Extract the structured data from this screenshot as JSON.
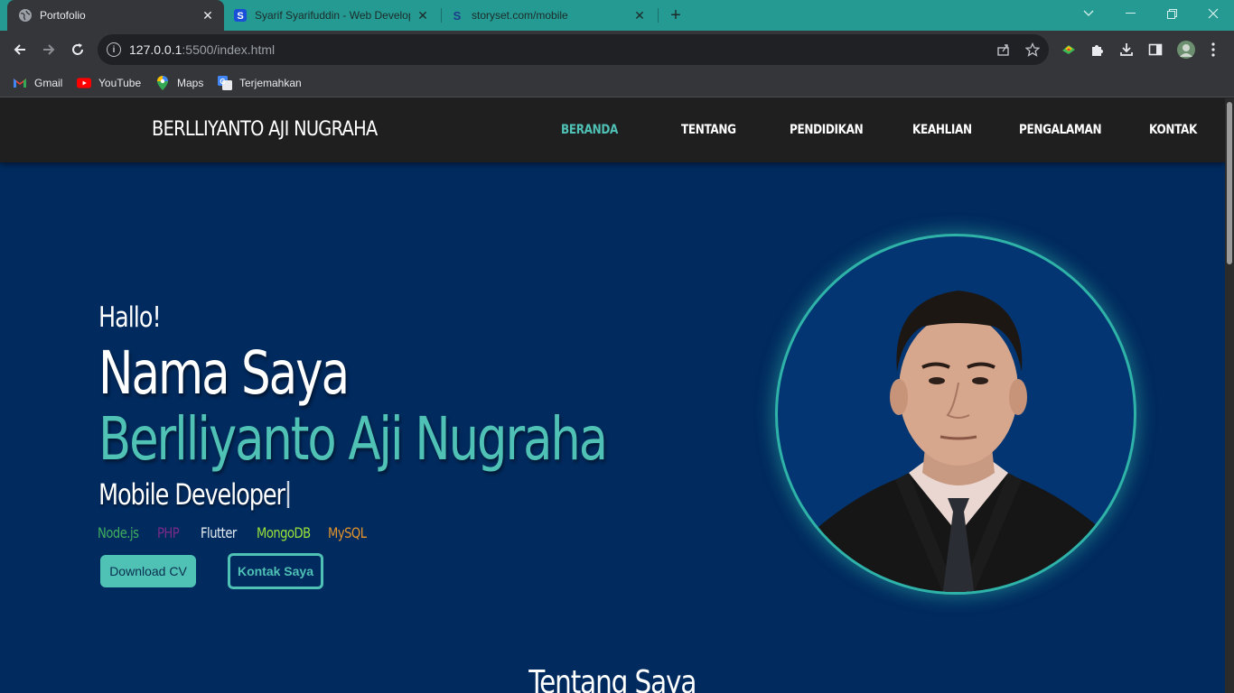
{
  "browser": {
    "tabs": [
      {
        "title": "Portofolio"
      },
      {
        "title": "Syarif Syarifuddin - Web Develop"
      },
      {
        "title": "storyset.com/mobile"
      }
    ],
    "url_host": "127.0.0.1",
    "url_rest": ":5500/index.html",
    "bookmarks": [
      {
        "label": "Gmail",
        "icon": "gmail-icon"
      },
      {
        "label": "YouTube",
        "icon": "youtube-icon"
      },
      {
        "label": "Maps",
        "icon": "maps-icon"
      },
      {
        "label": "Terjemahkan",
        "icon": "translate-icon"
      }
    ],
    "colors": {
      "tabstrip": "#249a92",
      "toolbar": "#35363a"
    }
  },
  "site": {
    "brand": "BERLLIYANTO AJI NUGRAHA",
    "nav": [
      {
        "label": "BERANDA",
        "active": true
      },
      {
        "label": "TENTANG",
        "active": false
      },
      {
        "label": "PENDIDIKAN",
        "active": false
      },
      {
        "label": "KEAHLIAN",
        "active": false
      },
      {
        "label": "PENGALAMAN",
        "active": false
      },
      {
        "label": "KONTAK",
        "active": false
      }
    ],
    "hero": {
      "greeting": "Hallo!",
      "name_label": "Nama Saya",
      "name": "Berlliyanto Aji Nugraha",
      "role": "Mobile Developer",
      "skills": [
        {
          "label": "Node.js",
          "color": "#3fae5f"
        },
        {
          "label": "PHP",
          "color": "#7a2a8a"
        },
        {
          "label": "Flutter",
          "color": "#e6edf3"
        },
        {
          "label": "MongoDB",
          "color": "#9be23a"
        },
        {
          "label": "MySQL",
          "color": "#e5952a"
        }
      ],
      "download_cv": "Download CV",
      "contact": "Kontak Saya"
    },
    "next_section_title": "Tentang Saya",
    "colors": {
      "accent": "#4fc1b5",
      "background": "#012a5e",
      "navbar": "#1f1f1f"
    }
  }
}
